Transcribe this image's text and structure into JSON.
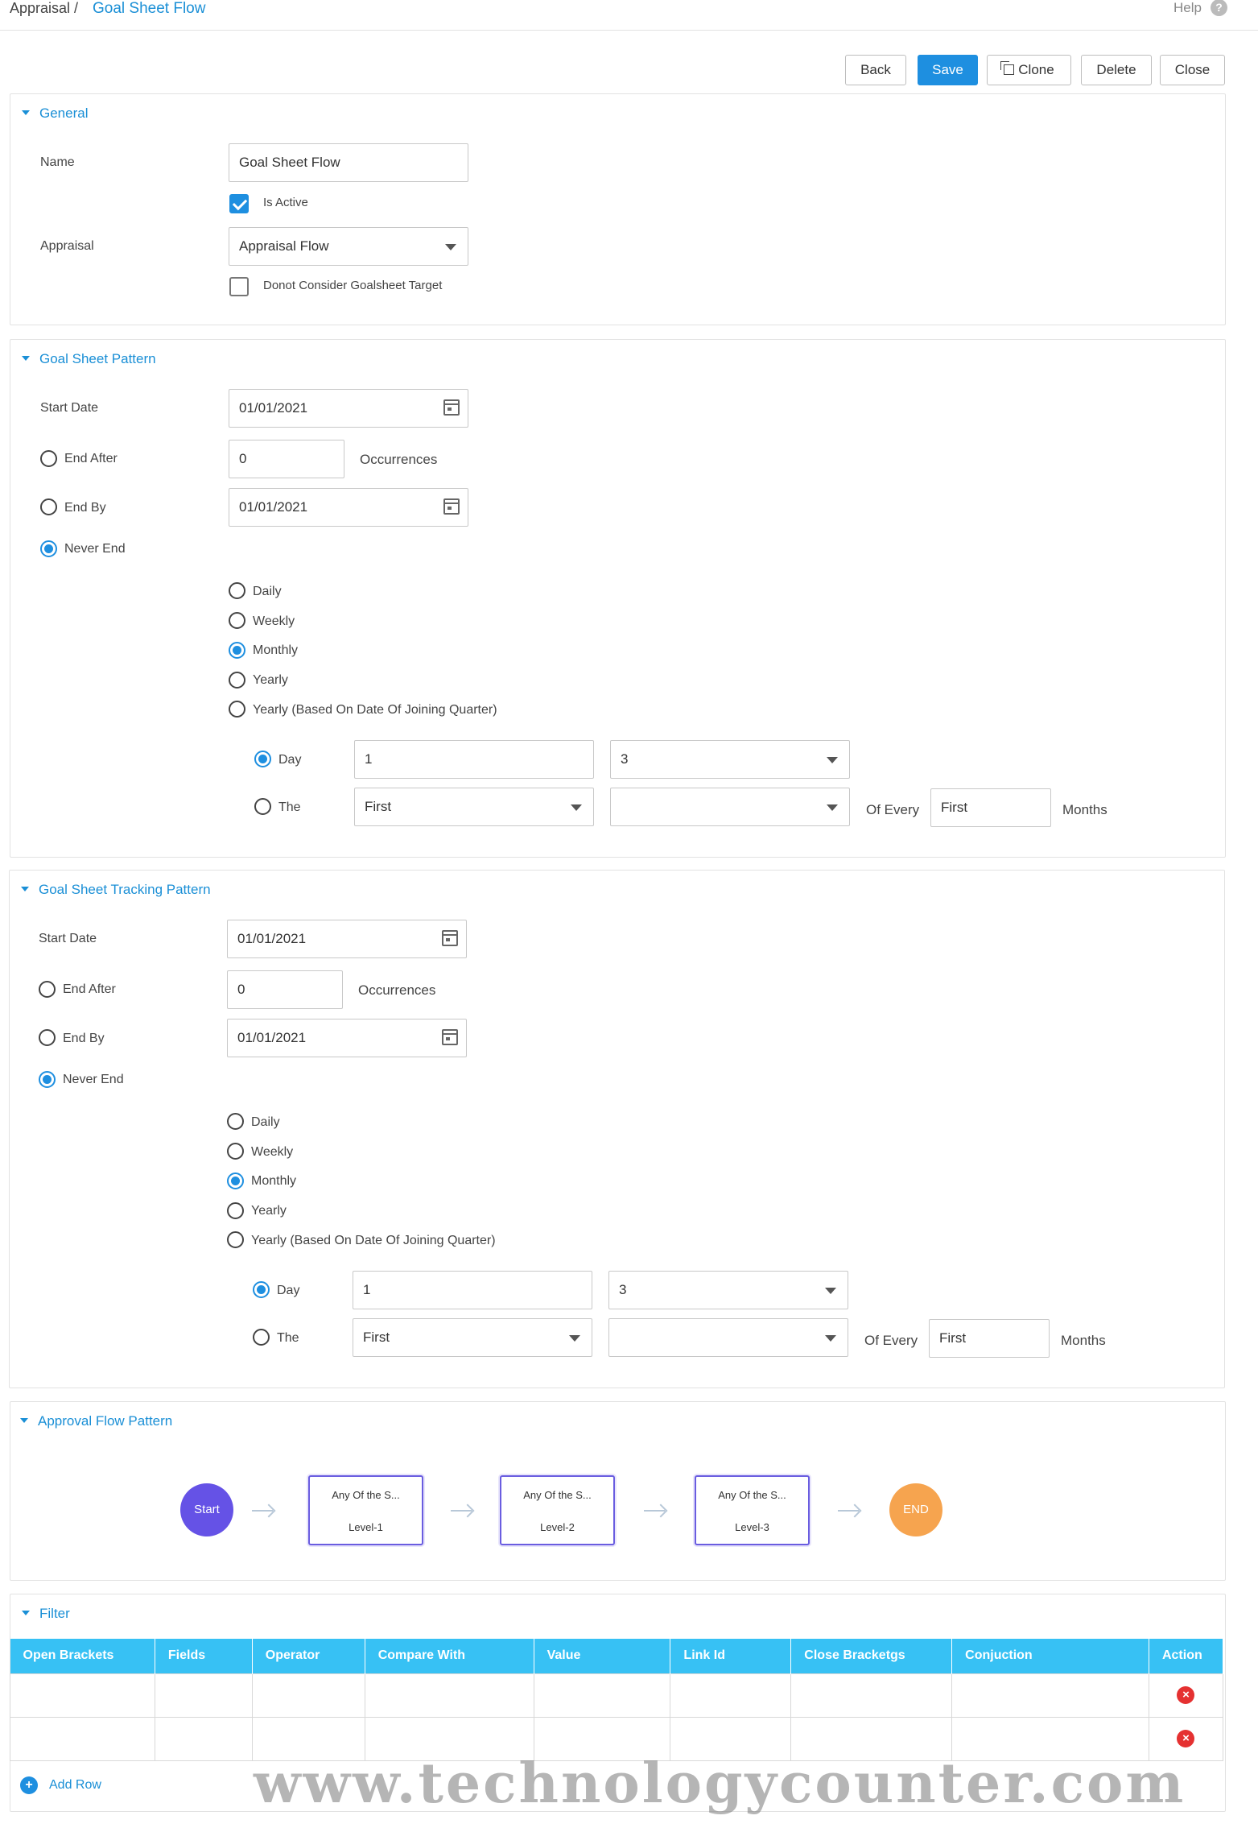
{
  "breadcrumb": {
    "root": "Appraisal /",
    "current": "Goal Sheet Flow"
  },
  "help": {
    "label": "Help",
    "icon": "?"
  },
  "toolbar": {
    "back": "Back",
    "save": "Save",
    "clone": "Clone",
    "delete": "Delete",
    "close": "Close"
  },
  "general": {
    "title": "General",
    "name_label": "Name",
    "name_value": "Goal Sheet Flow",
    "is_active_label": "Is Active",
    "is_active": true,
    "appraisal_label": "Appraisal",
    "appraisal_value": "Appraisal Flow",
    "donot_consider_label": "Donot Consider Goalsheet Target",
    "donot_consider": false
  },
  "goal_sheet_pattern": {
    "title": "Goal Sheet Pattern",
    "start_date_label": "Start Date",
    "start_date": "01/01/2021",
    "end_after_label": "End After",
    "end_after_value": "0",
    "occurrences_label": "Occurrences",
    "end_by_label": "End By",
    "end_by_date": "01/01/2021",
    "never_end_label": "Never End",
    "end_selected": "never_end",
    "recurrence": [
      "Daily",
      "Weekly",
      "Monthly",
      "Yearly",
      "Yearly (Based On Date Of Joining Quarter)"
    ],
    "recurrence_selected": "Monthly",
    "day_label": "Day",
    "day_value": "1",
    "day_month_value": "3",
    "the_label": "The",
    "the_value": "First",
    "the_weekday_value": "",
    "of_every_label": "Of Every",
    "of_every_value": "First",
    "months_label": "Months",
    "mode_selected": "day"
  },
  "tracking_pattern": {
    "title": "Goal Sheet Tracking Pattern",
    "start_date_label": "Start Date",
    "start_date": "01/01/2021",
    "end_after_label": "End After",
    "end_after_value": "0",
    "occurrences_label": "Occurrences",
    "end_by_label": "End By",
    "end_by_date": "01/01/2021",
    "never_end_label": "Never End",
    "end_selected": "never_end",
    "recurrence": [
      "Daily",
      "Weekly",
      "Monthly",
      "Yearly",
      "Yearly (Based On Date Of Joining Quarter)"
    ],
    "recurrence_selected": "Monthly",
    "day_label": "Day",
    "day_value": "1",
    "day_month_value": "3",
    "the_label": "The",
    "the_value": "First",
    "the_weekday_value": "",
    "of_every_label": "Of Every",
    "of_every_value": "First",
    "months_label": "Months",
    "mode_selected": "day"
  },
  "approval_flow": {
    "title": "Approval Flow Pattern",
    "start": "Start",
    "end": "END",
    "levels": [
      {
        "text": "Any Of the S...",
        "level": "Level-1"
      },
      {
        "text": "Any Of the S...",
        "level": "Level-2"
      },
      {
        "text": "Any Of the S...",
        "level": "Level-3"
      }
    ],
    "colors": {
      "start": "#6552e6",
      "end": "#f6a44f",
      "node_border": "#6a5de0"
    }
  },
  "filter": {
    "title": "Filter",
    "columns": [
      "Open Brackets",
      "Fields",
      "Operator",
      "Compare With",
      "Value",
      "Link Id",
      "Close Bracketgs",
      "Conjuction",
      "Action"
    ],
    "rows": [
      [
        "",
        "",
        "",
        "",
        "",
        "",
        "",
        "",
        ""
      ],
      [
        "",
        "",
        "",
        "",
        "",
        "",
        "",
        "",
        ""
      ]
    ],
    "add_row_label": "Add Row",
    "header_color": "#37c1f4"
  },
  "watermark": "www.technologycounter.com"
}
